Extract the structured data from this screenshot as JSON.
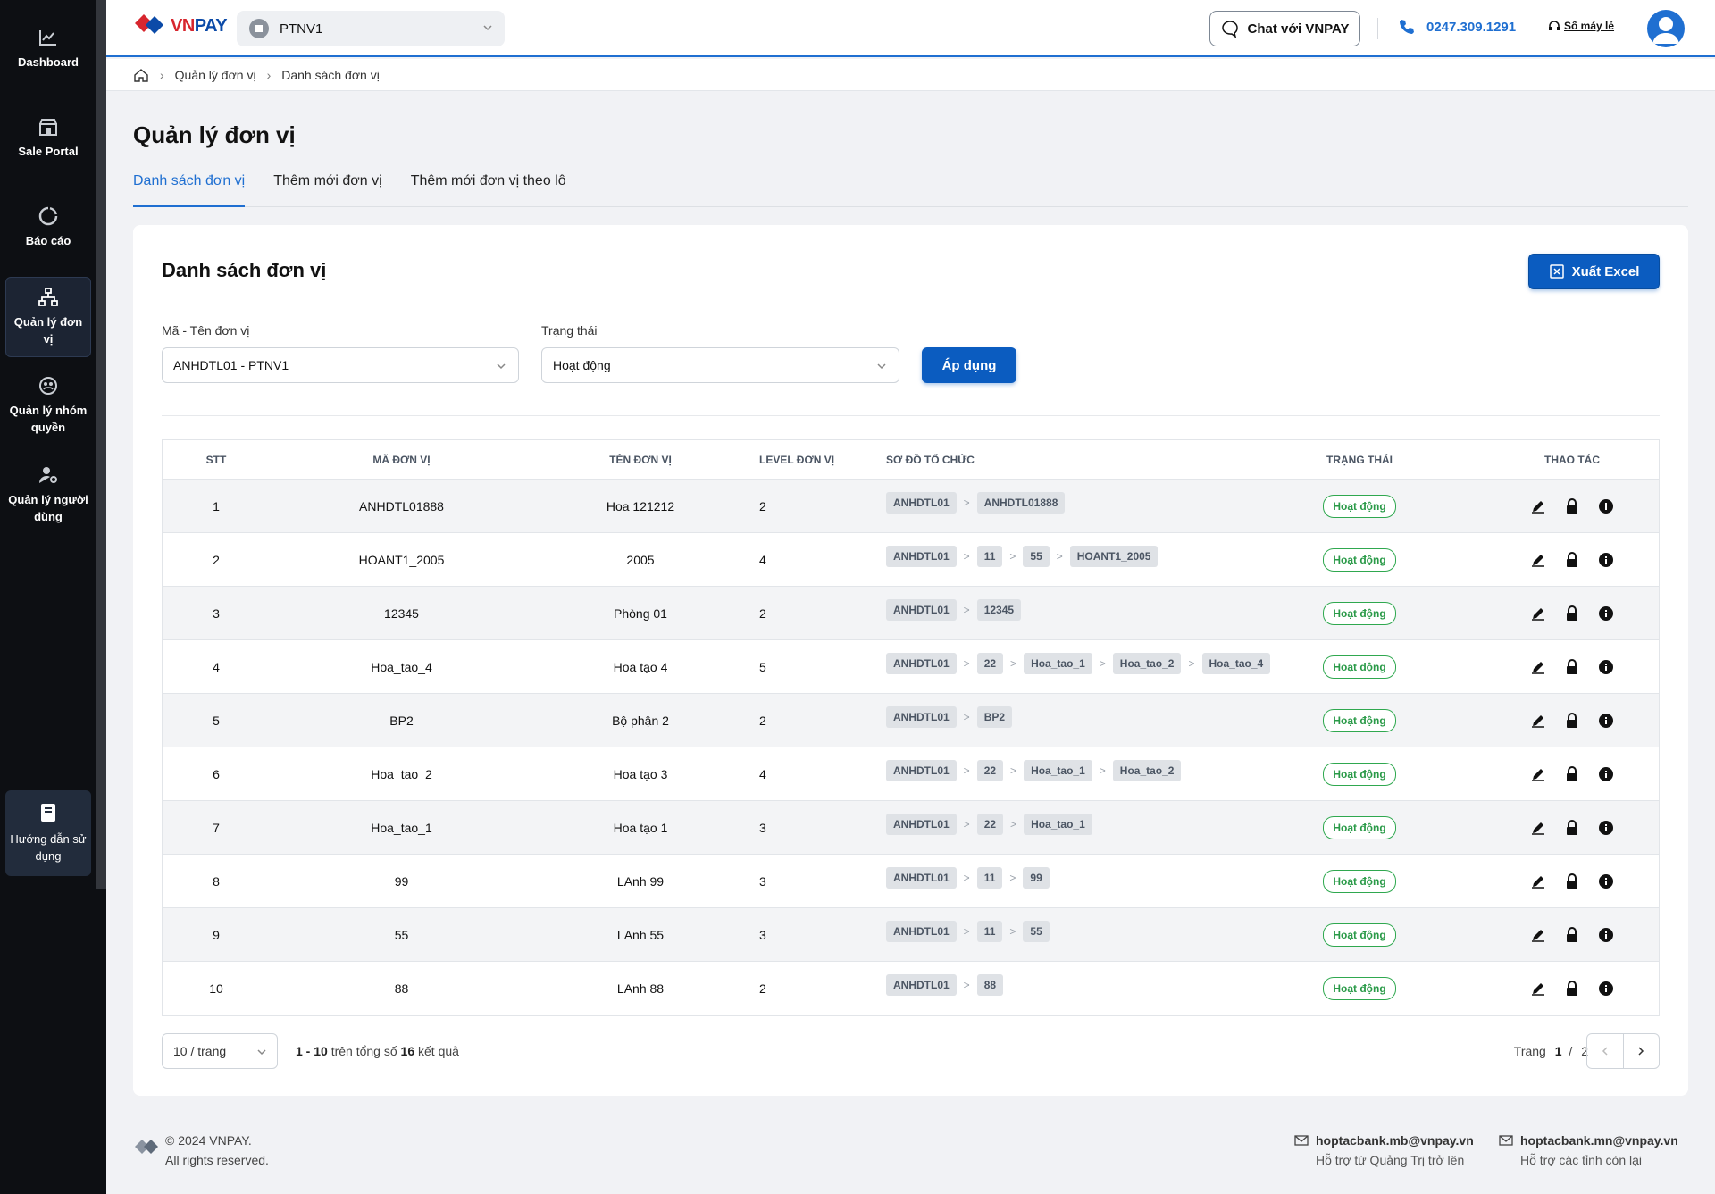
{
  "sidebar": {
    "items": [
      {
        "label": "Dashboard"
      },
      {
        "label": "Sale Portal"
      },
      {
        "label": "Báo cáo"
      },
      {
        "label": "Quản lý đơn vị"
      },
      {
        "label": "Quản lý nhóm quyền"
      },
      {
        "label": "Quản lý người dùng"
      }
    ],
    "help_label": "Hướng dẫn sử dụng"
  },
  "header": {
    "logo_text_a": "VN",
    "logo_text_b": "PAY",
    "org_name": "PTNV1",
    "chat_label": "Chat với VNPAY",
    "phone": "0247.309.1291",
    "hotline_label": "Số máy lẻ",
    "accent": "#1f6fd1"
  },
  "breadcrumb": {
    "items": [
      "Quản lý đơn vị",
      "Danh sách đơn vị"
    ]
  },
  "page": {
    "title": "Quản lý đơn vị",
    "tabs": [
      {
        "label": "Danh sách đơn vị",
        "active": true
      },
      {
        "label": "Thêm mới đơn vị",
        "active": false
      },
      {
        "label": "Thêm mới đơn vị theo lô",
        "active": false
      }
    ]
  },
  "card": {
    "title": "Danh sách đơn vị",
    "export_label": "Xuất Excel",
    "filters": {
      "unit_label": "Mã - Tên đơn vị",
      "unit_value": "ANHDTL01 - PTNV1",
      "status_label": "Trạng thái",
      "status_value": "Hoạt động",
      "apply_label": "Áp dụng"
    }
  },
  "table": {
    "headers": {
      "stt": "STT",
      "code": "MÃ ĐƠN VỊ",
      "name": "TÊN ĐƠN VỊ",
      "level": "LEVEL ĐƠN VỊ",
      "org": "SƠ ĐỒ TỔ CHỨC",
      "status": "TRẠNG THÁI",
      "actions": "THAO TÁC"
    },
    "rows": [
      {
        "stt": "1",
        "code": "ANHDTL01888",
        "name": "Hoa 121212",
        "level": "2",
        "org": [
          "ANHDTL01",
          "ANHDTL01888"
        ],
        "status": "Hoạt động"
      },
      {
        "stt": "2",
        "code": "HOANT1_2005",
        "name": "2005",
        "level": "4",
        "org": [
          "ANHDTL01",
          "11",
          "55",
          "HOANT1_2005"
        ],
        "status": "Hoạt động"
      },
      {
        "stt": "3",
        "code": "12345",
        "name": "Phòng 01",
        "level": "2",
        "org": [
          "ANHDTL01",
          "12345"
        ],
        "status": "Hoạt động"
      },
      {
        "stt": "4",
        "code": "Hoa_tao_4",
        "name": "Hoa tạo 4",
        "level": "5",
        "org": [
          "ANHDTL01",
          "22",
          "Hoa_tao_1",
          "Hoa_tao_2",
          "Hoa_tao_4"
        ],
        "status": "Hoạt động"
      },
      {
        "stt": "5",
        "code": "BP2",
        "name": "Bộ phận 2",
        "level": "2",
        "org": [
          "ANHDTL01",
          "BP2"
        ],
        "status": "Hoạt động"
      },
      {
        "stt": "6",
        "code": "Hoa_tao_2",
        "name": "Hoa tạo 3",
        "level": "4",
        "org": [
          "ANHDTL01",
          "22",
          "Hoa_tao_1",
          "Hoa_tao_2"
        ],
        "status": "Hoạt động"
      },
      {
        "stt": "7",
        "code": "Hoa_tao_1",
        "name": "Hoa tạo 1",
        "level": "3",
        "org": [
          "ANHDTL01",
          "22",
          "Hoa_tao_1"
        ],
        "status": "Hoạt động"
      },
      {
        "stt": "8",
        "code": "99",
        "name": "LAnh 99",
        "level": "3",
        "org": [
          "ANHDTL01",
          "11",
          "99"
        ],
        "status": "Hoạt động"
      },
      {
        "stt": "9",
        "code": "55",
        "name": "LAnh 55",
        "level": "3",
        "org": [
          "ANHDTL01",
          "11",
          "55"
        ],
        "status": "Hoạt động"
      },
      {
        "stt": "10",
        "code": "88",
        "name": "LAnh 88",
        "level": "2",
        "org": [
          "ANHDTL01",
          "88"
        ],
        "status": "Hoạt động"
      }
    ]
  },
  "pagination": {
    "page_size": "10 / trang",
    "range": "1 - 10",
    "total_prefix": "trên tổng số",
    "total": "16",
    "total_suffix": "kết quả",
    "page_label": "Trang",
    "current": "1",
    "separator": "/",
    "pages": "2"
  },
  "footer": {
    "copyright": "© 2024 VNPAY.",
    "rights": "All rights reserved.",
    "contacts": [
      {
        "email": "hoptacbank.mb@vnpay.vn",
        "note": "Hỗ trợ từ Quảng Trị trở lên"
      },
      {
        "email": "hoptacbank.mn@vnpay.vn",
        "note": "Hỗ trợ các tỉnh còn lại"
      }
    ]
  }
}
